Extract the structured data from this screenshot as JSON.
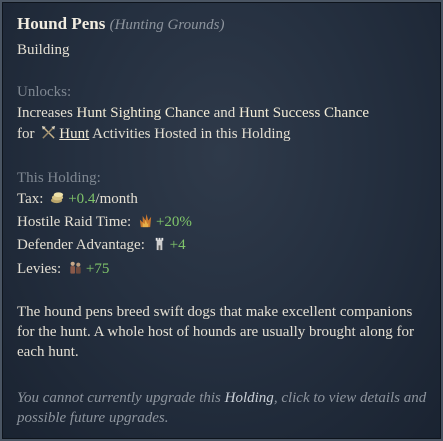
{
  "tooltip": {
    "title": "Hound Pens",
    "subtitle_paren": "(Hunting Grounds)",
    "type": "Building",
    "unlocks": {
      "heading": "Unlocks:",
      "line1_pre": "Increases ",
      "line1_k1": "Hunt Sighting Chance",
      "line1_mid": " and ",
      "line1_k2": "Hunt Success Chance",
      "line2_pre": "for",
      "line2_link": "Hunt",
      "line2_post": " Activities Hosted in this Holding"
    },
    "holding": {
      "heading": "This Holding:",
      "tax_label": "Tax:",
      "tax_value": "+0.4",
      "tax_unit": "/month",
      "raid_label": "Hostile Raid Time:",
      "raid_value": "+20%",
      "defender_label": "Defender Advantage:",
      "defender_value": "+4",
      "levies_label": "Levies:",
      "levies_value": "+75"
    },
    "description": "The hound pens breed swift dogs that make excellent companions for the hunt. A whole host of hounds are usually brought along for each hunt.",
    "footer_pre": "You cannot currently upgrade this ",
    "footer_kw": "Holding",
    "footer_post": ", click to view details and possible future upgrades.",
    "icons": {
      "hunt": "crossed-spears-icon",
      "tax": "coins-icon",
      "raid": "flames-icon",
      "defender": "tower-icon",
      "levies": "soldiers-icon"
    }
  }
}
